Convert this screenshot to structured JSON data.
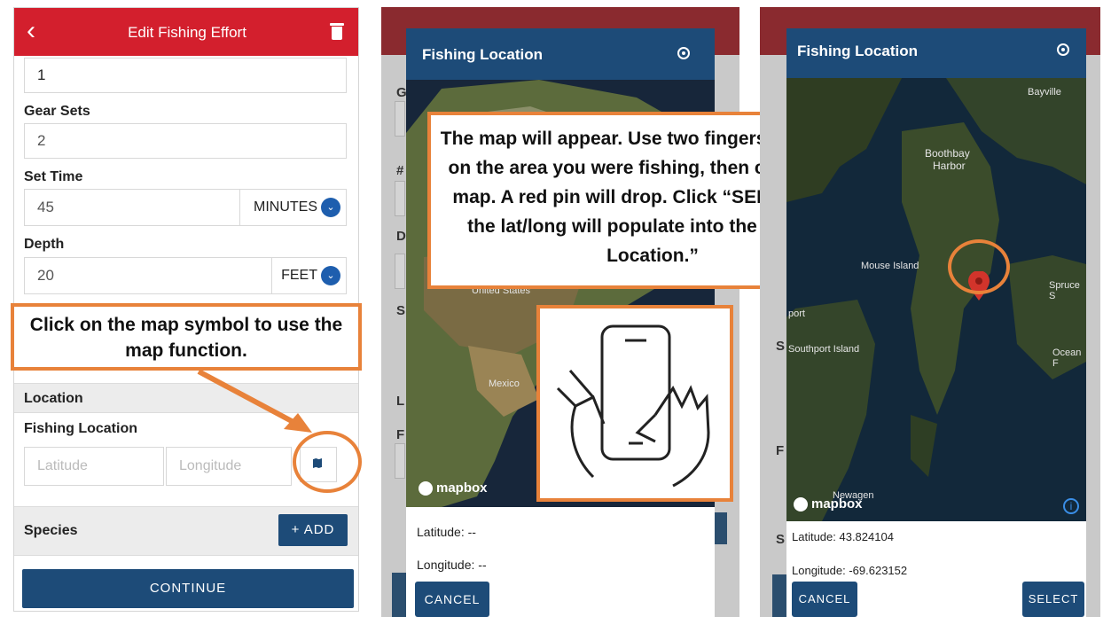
{
  "panel1": {
    "header_title": "Edit Fishing Effort",
    "field_first_value": "1",
    "gear_sets_label": "Gear Sets",
    "gear_sets_value": "2",
    "set_time_label": "Set Time",
    "set_time_value": "45",
    "set_time_unit": "MINUTES",
    "depth_label": "Depth",
    "depth_value": "20",
    "depth_unit": "FEET",
    "callout": "Click on the map symbol to use the map function.",
    "location_section": "Location",
    "fishing_location_label": "Fishing Location",
    "latitude_placeholder": "Latitude",
    "longitude_placeholder": "Longitude",
    "species_label": "Species",
    "add_label": "+ ADD",
    "continue_label": "CONTINUE"
  },
  "panel2": {
    "modal_title": "Fishing Location",
    "callout": "The map will appear. Use two fingers to zoom in on the area you were fishing, then click on the map. A red pin will drop. Click “SELECT” and the lat/long will populate into the “Fishing Location.”",
    "map_labels": {
      "usa": "United States",
      "mexico": "Mexico"
    },
    "mapbox_label": "mapbox",
    "latitude_text": "Latitude: --",
    "longitude_text": "Longitude: --",
    "cancel_label": "CANCEL"
  },
  "panel3": {
    "modal_title": "Fishing Location",
    "map_labels": {
      "bayville": "Bayville",
      "boothbay": "Boothbay",
      "harbor": "Harbor",
      "mouse_island": "Mouse Island",
      "spruce": "Spruce S",
      "port": "port",
      "southport_island": "Southport Island",
      "ocean": "Ocean F",
      "newagen": "Newagen"
    },
    "mapbox_label": "mapbox",
    "latitude_text": "Latitude: 43.824104",
    "longitude_text": "Longitude: -69.623152",
    "cancel_label": "CANCEL",
    "select_label": "SELECT"
  },
  "background_letters": [
    "G",
    "#",
    "D",
    "S",
    "L",
    "F"
  ],
  "colors": {
    "header_red": "#d31f2d",
    "navy": "#1d4b78",
    "callout_orange": "#e8823a",
    "chevron_blue": "#1e5eae",
    "pin_red": "#d2342b"
  }
}
